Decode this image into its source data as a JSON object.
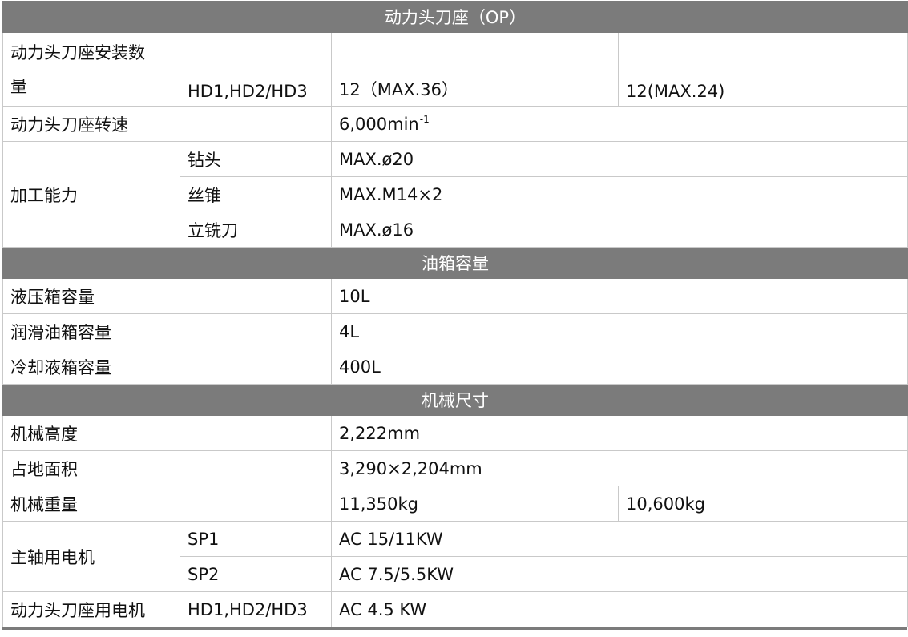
{
  "sections": {
    "power_turret": {
      "title": "动力头刀座（OP）",
      "install_count": {
        "label_line1": "动力头刀座安装数",
        "label_line2": "量",
        "sub": "HD1,HD2/HD3",
        "value1": "12（MAX.36）",
        "value2": "12(MAX.24)"
      },
      "speed": {
        "label": "动力头刀座转速",
        "value": "6,000min",
        "unit_sup": "-1"
      },
      "capability": {
        "label": "加工能力",
        "rows": [
          {
            "sub": "钻头",
            "value": "MAX.ø20"
          },
          {
            "sub": "丝锥",
            "value": "MAX.M14×2"
          },
          {
            "sub": "立铣刀",
            "value": "MAX.ø16"
          }
        ]
      }
    },
    "tank": {
      "title": "油箱容量",
      "rows": [
        {
          "label": "液压箱容量",
          "value": "10L"
        },
        {
          "label": "润滑油箱容量",
          "value": "4L"
        },
        {
          "label": "冷却液箱容量",
          "value": "400L"
        }
      ]
    },
    "dimensions": {
      "title": "机械尺寸",
      "height": {
        "label": "机械高度",
        "value": "2,222mm"
      },
      "footprint": {
        "label": "占地面积",
        "value": "3,290×2,204mm"
      },
      "weight": {
        "label": "机械重量",
        "value1": "11,350kg",
        "value2": "10,600kg"
      },
      "spindle_motor": {
        "label": "主轴用电机",
        "rows": [
          {
            "sub": "SP1",
            "value": "AC 15/11KW"
          },
          {
            "sub": "SP2",
            "value": "AC 7.5/5.5KW"
          }
        ]
      },
      "turret_motor": {
        "label": "动力头刀座用电机",
        "sub": "HD1,HD2/HD3",
        "value": "AC 4.5 KW"
      }
    }
  },
  "colors": {
    "header_bg": "#7b7b7b",
    "header_text": "#ffffff",
    "border": "#c9c9c9"
  }
}
